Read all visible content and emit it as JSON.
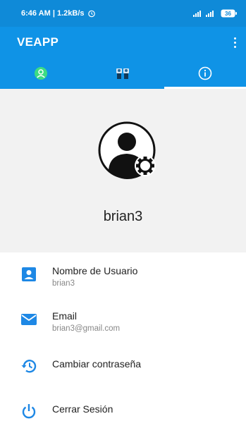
{
  "status_bar": {
    "time_network": "6:46 AM | 1.2kB/s",
    "battery": "36"
  },
  "app_bar": {
    "title": "VEAPP"
  },
  "tabs": [
    {
      "icon": "person-icon",
      "active": false
    },
    {
      "icon": "people-icon",
      "active": false
    },
    {
      "icon": "info-icon",
      "active": true
    }
  ],
  "profile": {
    "username": "brian3"
  },
  "list": [
    {
      "title": "Nombre de Usuario",
      "subtitle": "brian3",
      "icon": "account-box-icon"
    },
    {
      "title": "Email",
      "subtitle": "brian3@gmail.com",
      "icon": "email-icon"
    },
    {
      "title": "Cambiar contraseña",
      "icon": "restore-icon"
    },
    {
      "title": "Cerrar Sesión",
      "icon": "power-icon"
    }
  ],
  "colors": {
    "primary": "#0f93e6",
    "status": "#0f8ad8",
    "accent_green": "#3ddc84",
    "icon_blue": "#1e88e5"
  }
}
